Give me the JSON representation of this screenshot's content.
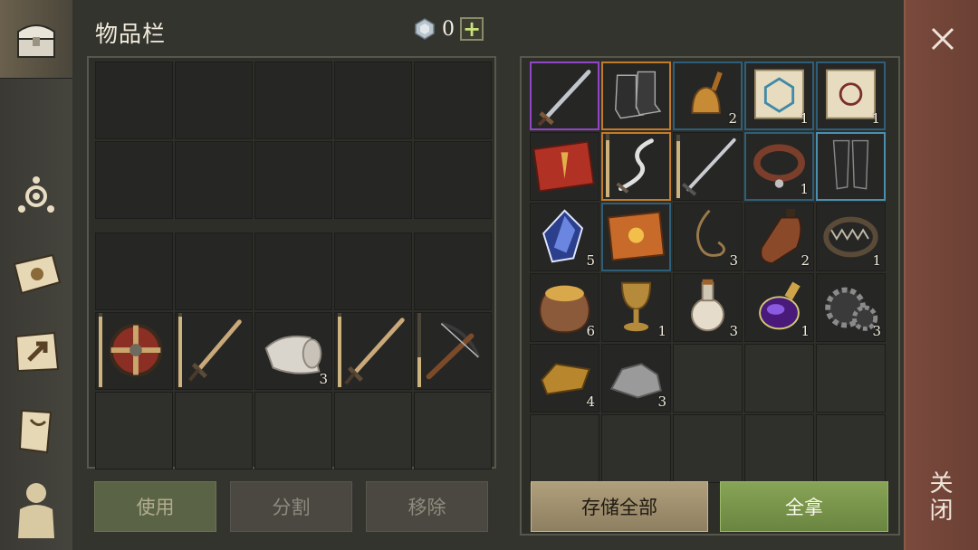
{
  "header": {
    "title": "物品栏",
    "currency_value": "0",
    "currency_add": "+"
  },
  "player_inventory": {
    "equipped": [
      {
        "name": "round-shield-icon",
        "qty": "",
        "durability": 0.95
      },
      {
        "name": "short-sword-icon",
        "qty": "",
        "durability": 0.95
      },
      {
        "name": "bandage-roll-icon",
        "qty": "3"
      },
      {
        "name": "long-sword-icon",
        "qty": "",
        "durability": 0.95
      },
      {
        "name": "crossbow-icon",
        "qty": "",
        "durability": 0.4
      }
    ]
  },
  "storage": {
    "items": [
      {
        "name": "purple-sword-icon",
        "qty": "",
        "rarity": "purple"
      },
      {
        "name": "boots-icon",
        "qty": "",
        "rarity": "orange"
      },
      {
        "name": "bell-icon",
        "qty": "2",
        "rarity": "blue"
      },
      {
        "name": "blue-scroll-icon",
        "qty": "1",
        "rarity": "blue"
      },
      {
        "name": "red-scroll-icon",
        "qty": "1",
        "rarity": "blue"
      },
      {
        "name": "red-book-icon",
        "qty": "",
        "rarity": "none"
      },
      {
        "name": "curved-dagger-icon",
        "qty": "",
        "rarity": "orange",
        "durability": 0.9
      },
      {
        "name": "steel-sword-icon",
        "qty": "",
        "rarity": "none",
        "durability": 0.9
      },
      {
        "name": "collar-icon",
        "qty": "1",
        "rarity": "blue"
      },
      {
        "name": "leg-armor-icon",
        "qty": "",
        "rarity": "lblue"
      },
      {
        "name": "crystal-icon",
        "qty": "5",
        "rarity": "none"
      },
      {
        "name": "orange-book-icon",
        "qty": "",
        "rarity": "blue"
      },
      {
        "name": "rope-icon",
        "qty": "3",
        "rarity": "none"
      },
      {
        "name": "leather-flask-icon",
        "qty": "2",
        "rarity": "none"
      },
      {
        "name": "bear-trap-icon",
        "qty": "1",
        "rarity": "none"
      },
      {
        "name": "grain-sack-icon",
        "qty": "6",
        "rarity": "none"
      },
      {
        "name": "goblet-icon",
        "qty": "1",
        "rarity": "none"
      },
      {
        "name": "potion-icon",
        "qty": "3",
        "rarity": "none"
      },
      {
        "name": "purple-potion-icon",
        "qty": "1",
        "rarity": "none"
      },
      {
        "name": "gear-icon",
        "qty": "3",
        "rarity": "none"
      },
      {
        "name": "gold-bar-icon",
        "qty": "4",
        "rarity": "none"
      },
      {
        "name": "stone-icon",
        "qty": "3",
        "rarity": "none"
      }
    ]
  },
  "buttons": {
    "use": "使用",
    "split": "分割",
    "remove": "移除",
    "store_all": "存储全部",
    "take_all": "全拿"
  },
  "close_label": "关闭",
  "colors": {
    "purple": "#9146c7",
    "orange": "#c27b2b",
    "blue": "#2d5f7a",
    "accent_green": "#88a456"
  }
}
